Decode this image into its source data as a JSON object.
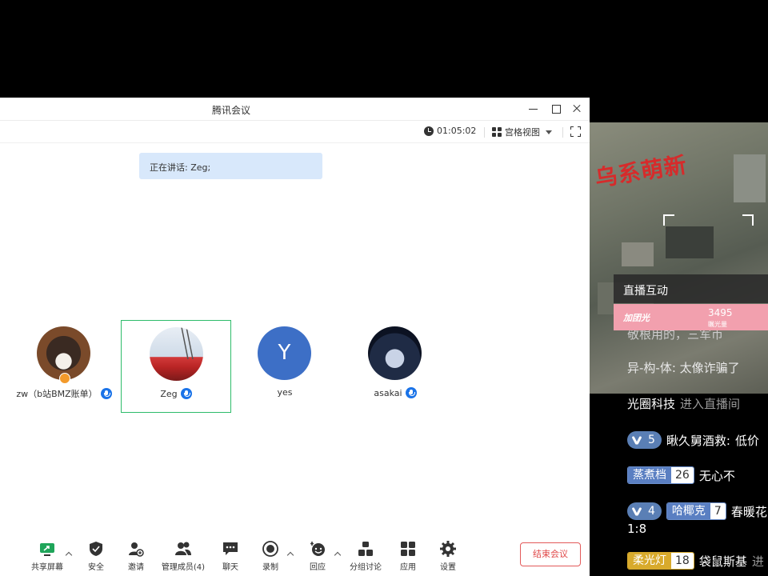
{
  "window": {
    "title": "腾讯会议",
    "timer": "01:05:02",
    "view_label": "宫格视图"
  },
  "speaking_banner": "正在讲话: Zeg;",
  "participants": [
    {
      "name": "zw（b站BMZ账单）",
      "avatar_type": "dog-photo",
      "is_host": true,
      "mic": "on"
    },
    {
      "name": "Zeg",
      "avatar_type": "sky-photo",
      "active_speaker": true,
      "mic": "on"
    },
    {
      "name": "yes",
      "avatar_letter": "Y",
      "avatar_color": "#3d6fc6"
    },
    {
      "name": "asakai",
      "avatar_type": "anime-photo",
      "mic": "muted-speaking"
    }
  ],
  "toolbar": {
    "share_screen": "共享屏幕",
    "security": "安全",
    "invite": "邀请",
    "manage_members": "管理成员(4)",
    "chat": "聊天",
    "record": "录制",
    "react": "回应",
    "breakout": "分组讨论",
    "apps": "应用",
    "settings": "设置",
    "end_meeting": "结束会议"
  },
  "stream": {
    "overlay_brand": "乌系萌新",
    "interact_title": "直播互动",
    "glow_label": "加团光",
    "glow_count": "3495",
    "glow_unit": "瞩光量",
    "chat": [
      {
        "text": "敬根用的，三军币",
        "style": "dim-partial"
      },
      {
        "text": "异-构-体: 太像诈骗了"
      },
      {
        "user": "光圈科技",
        "action": "进入直播间"
      },
      {
        "fan_level": "5",
        "user": "瞅久舅酒救:",
        "text": "低价"
      },
      {
        "medal": "蒸煮档",
        "medal_level": "26",
        "text": "无心不"
      },
      {
        "fan_level": "4",
        "medal": "哈椰克",
        "medal_level": "7",
        "text": "春暖花"
      },
      {
        "text": "1:8"
      },
      {
        "medal": "柔光灯",
        "medal_level": "18",
        "user": "袋鼠斯基",
        "action": "进"
      }
    ]
  },
  "colors": {
    "accent_green": "#2ebc6a",
    "end_red": "#e04848",
    "mic_blue": "#1a73e8"
  }
}
